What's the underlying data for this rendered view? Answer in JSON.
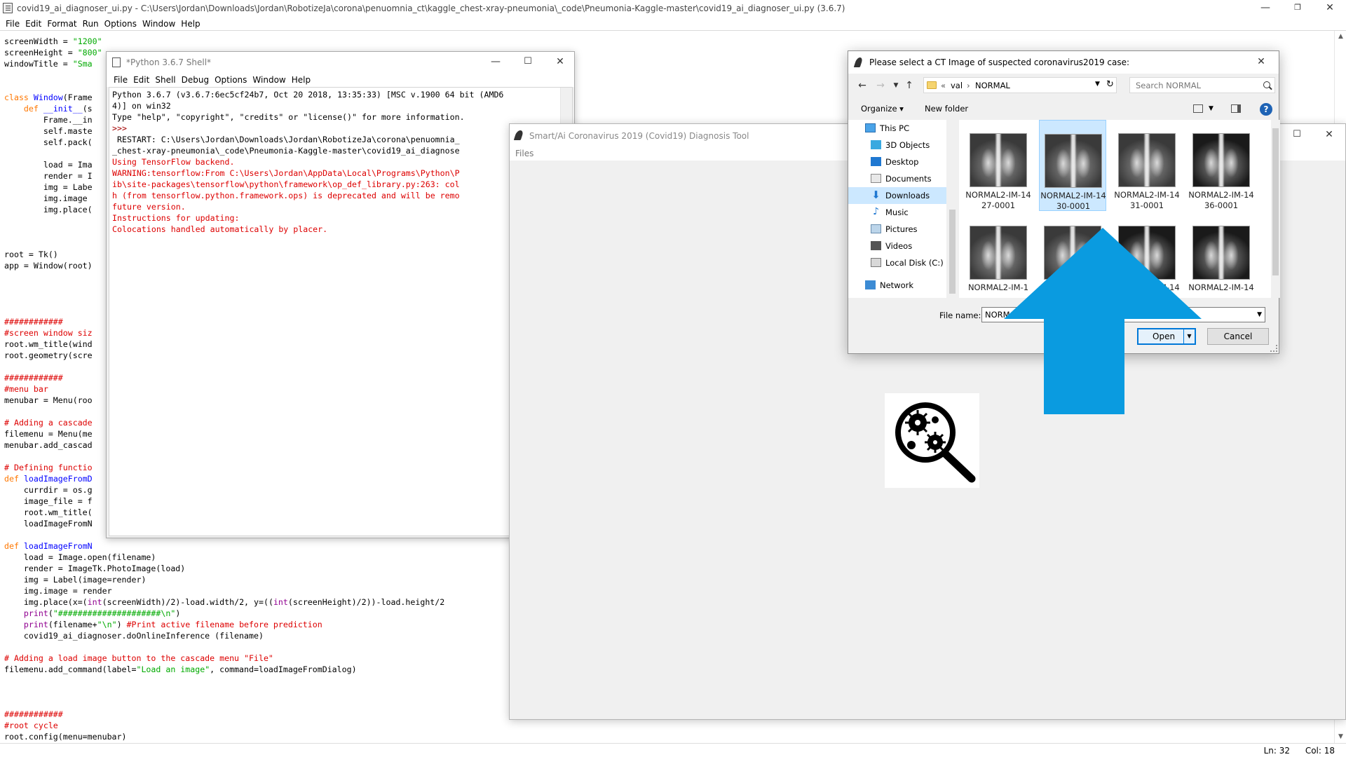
{
  "editor": {
    "title": "covid19_ai_diagnoser_ui.py - C:\\Users\\Jordan\\Downloads\\Jordan\\RobotizeJa\\corona\\penuomnia_ct\\kaggle_chest-xray-pneumonia\\_code\\Pneumonia-Kaggle-master\\covid19_ai_diagnoser_ui.py (3.6.7)",
    "menu": [
      "File",
      "Edit",
      "Format",
      "Run",
      "Options",
      "Window",
      "Help"
    ],
    "status": {
      "line": "Ln: 32",
      "col": "Col: 18"
    }
  },
  "shell": {
    "title": "*Python 3.6.7 Shell*",
    "menu": [
      "File",
      "Edit",
      "Shell",
      "Debug",
      "Options",
      "Window",
      "Help"
    ]
  },
  "tool": {
    "title": "Smart/Ai Coronavirus 2019 (Covid19) Diagnosis Tool",
    "menu_files": "Files"
  },
  "dialog": {
    "title": "Please select a CT Image of suspected coronavirus2019 case:",
    "path": {
      "prefix": "«",
      "parent": "val",
      "current": "NORMAL"
    },
    "search_placeholder": "Search NORMAL",
    "organize": "Organize ▾",
    "new_folder": "New folder",
    "nav_items": [
      "This PC",
      "3D Objects",
      "Desktop",
      "Documents",
      "Downloads",
      "Music",
      "Pictures",
      "Videos",
      "Local Disk (C:)",
      "Network"
    ],
    "files": [
      {
        "line1": "NORMAL2-IM-14",
        "line2": "27-0001"
      },
      {
        "line1": "NORMAL2-IM-14",
        "line2": "30-0001"
      },
      {
        "line1": "NORMAL2-IM-14",
        "line2": "31-0001"
      },
      {
        "line1": "NORMAL2-IM-14",
        "line2": "36-0001"
      },
      {
        "line1": "NORMAL2-IM-1",
        "line2": ""
      },
      {
        "line1": "",
        "line2": ""
      },
      {
        "line1": "NORMAL2-IM-14",
        "line2": ""
      },
      {
        "line1": "NORMAL2-IM-14",
        "line2": ""
      }
    ],
    "file_name_label": "File name:",
    "file_name_value": "NORMAL",
    "open_label": "Open",
    "cancel_label": "Cancel"
  },
  "colors": {
    "annotation_arrow": "#0a9be0",
    "selection": "#cce8ff",
    "error_text": "#dd0000"
  },
  "icons": [
    "idle-file-icon",
    "feather-icon",
    "folder-icon",
    "search-icon",
    "help-icon",
    "virus-magnifier-icon",
    "up-arrow-annotation"
  ]
}
